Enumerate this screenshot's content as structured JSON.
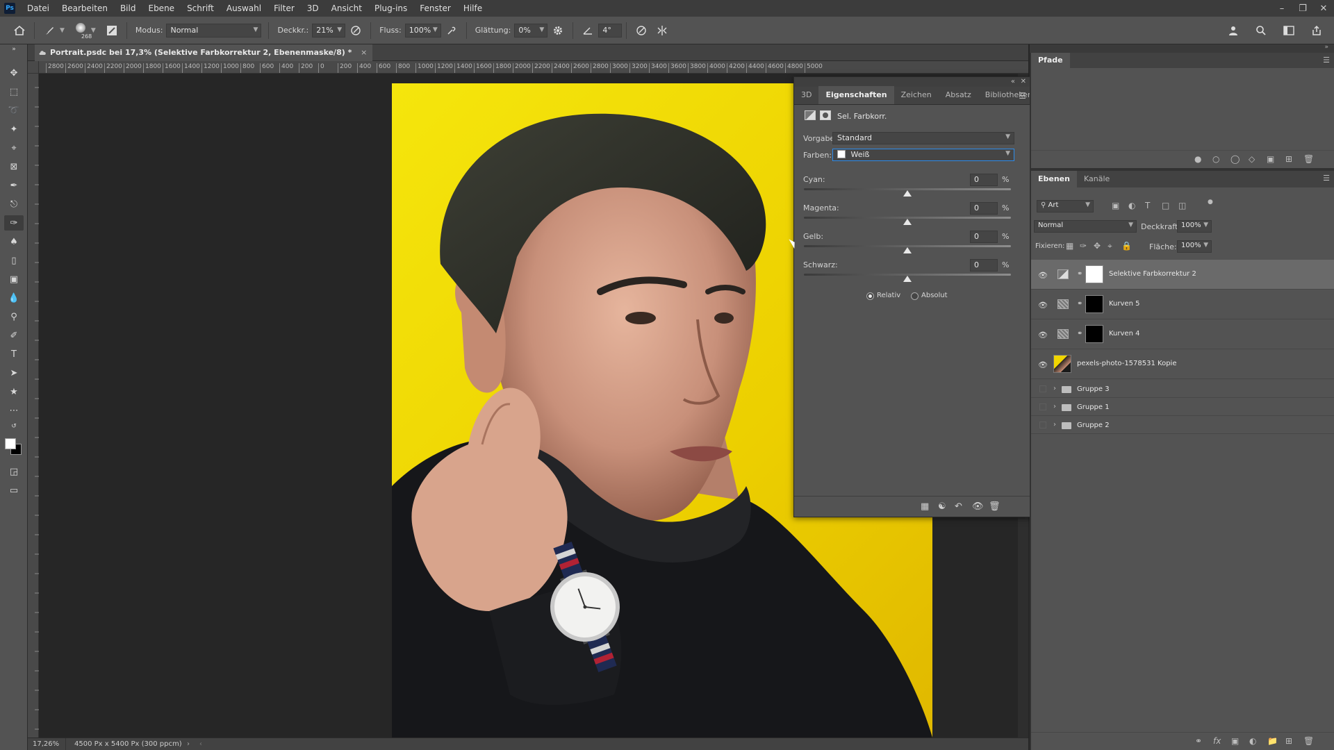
{
  "menu": [
    "Datei",
    "Bearbeiten",
    "Bild",
    "Ebene",
    "Schrift",
    "Auswahl",
    "Filter",
    "3D",
    "Ansicht",
    "Plug-ins",
    "Fenster",
    "Hilfe"
  ],
  "options": {
    "brush_size": "268",
    "mode_label": "Modus:",
    "mode_value": "Normal",
    "opacity_label": "Deckkr.:",
    "opacity_value": "21%",
    "flow_label": "Fluss:",
    "flow_value": "100%",
    "smoothing_label": "Glättung:",
    "smoothing_value": "0%",
    "angle_value": "4°"
  },
  "document": {
    "tab_title": "Portrait.psdc bei 17,3% (Selektive Farbkorrektur 2, Ebenenmaske/8) *",
    "close": "×"
  },
  "ruler_labels": [
    "2800",
    "2600",
    "2400",
    "2200",
    "2000",
    "1800",
    "1600",
    "1400",
    "1200",
    "1000",
    "800",
    "600",
    "400",
    "200",
    "0",
    "200",
    "400",
    "600",
    "800",
    "1000",
    "1200",
    "1400",
    "1600",
    "1800",
    "2000",
    "2200",
    "2400",
    "2600",
    "2800",
    "3000",
    "3200",
    "3400",
    "3600",
    "3800",
    "4000",
    "4200",
    "4400",
    "4600",
    "4800",
    "5000"
  ],
  "status": {
    "zoom": "17,26%",
    "doc_size": "4500 Px x 5400 Px (300 ppcm)"
  },
  "properties": {
    "tabs": [
      "3D",
      "Eigenschaften",
      "Zeichen",
      "Absatz",
      "Bibliotheken"
    ],
    "active_tab": "Eigenschaften",
    "adjustment_name": "Sel. Farbkorr.",
    "preset_label": "Vorgabe:",
    "preset_value": "Standard",
    "colors_label": "Farben:",
    "colors_value": "Weiß",
    "sliders": [
      {
        "label": "Cyan:",
        "value": "0",
        "unit": "%"
      },
      {
        "label": "Magenta:",
        "value": "0",
        "unit": "%"
      },
      {
        "label": "Gelb:",
        "value": "0",
        "unit": "%"
      },
      {
        "label": "Schwarz:",
        "value": "0",
        "unit": "%"
      }
    ],
    "method_relative": "Relativ",
    "method_absolute": "Absolut",
    "selected_method": "Relativ"
  },
  "paths_panel": {
    "tab": "Pfade"
  },
  "layers_panel": {
    "tabs": [
      "Ebenen",
      "Kanäle"
    ],
    "filter_kind": "Art",
    "blend_mode": "Normal",
    "opacity_label": "Deckkraft:",
    "opacity_value": "100%",
    "lock_label": "Fixieren:",
    "fill_label": "Fläche:",
    "fill_value": "100%",
    "layers": [
      {
        "name": "Selektive Farbkorrektur 2",
        "type": "adjustment",
        "visible": true,
        "selected": true,
        "mask": "white"
      },
      {
        "name": "Kurven 5",
        "type": "curves",
        "visible": true,
        "selected": false,
        "mask": "black"
      },
      {
        "name": "Kurven 4",
        "type": "curves",
        "visible": true,
        "selected": false,
        "mask": "black"
      },
      {
        "name": "pexels-photo-1578531 Kopie",
        "type": "image",
        "visible": true,
        "selected": false,
        "mask": "none"
      },
      {
        "name": "Gruppe 3",
        "type": "group",
        "visible": false,
        "selected": false
      },
      {
        "name": "Gruppe 1",
        "type": "group",
        "visible": false,
        "selected": false
      },
      {
        "name": "Gruppe 2",
        "type": "group",
        "visible": false,
        "selected": false
      }
    ]
  },
  "colors": {
    "accent": "#2d8ceb",
    "background_yellow": "#f5e60c",
    "panel": "#535353"
  }
}
